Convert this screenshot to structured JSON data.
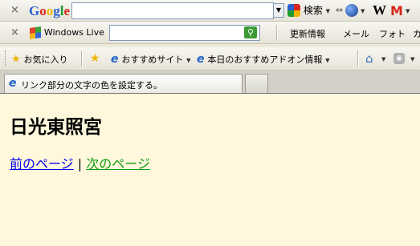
{
  "google_toolbar": {
    "logo_letters": [
      "G",
      "o",
      "o",
      "g",
      "l",
      "e"
    ],
    "logo_colors": [
      "#2a5fcf",
      "#d6281d",
      "#f0b400",
      "#2a5fcf",
      "#1f9a2f",
      "#d6281d"
    ],
    "search_value": "",
    "search_label": "検索"
  },
  "live_toolbar": {
    "brand": "Windows Live",
    "search_value": "",
    "menu": [
      "更新情報",
      "メール",
      "フォト",
      "カ"
    ]
  },
  "favorites_bar": {
    "favorites_label": "お気に入り",
    "items": [
      "おすすめサイト",
      "本日のおすすめアドオン情報"
    ]
  },
  "tab": {
    "title": "リンク部分の文字の色を設定する。"
  },
  "page": {
    "heading": "日光東照宮",
    "prev_link": "前のページ",
    "separator": "|",
    "next_link": "次のページ",
    "background": "#fff8dc",
    "prev_link_color": "#0000ee",
    "next_link_color": "#0e9c0e"
  }
}
